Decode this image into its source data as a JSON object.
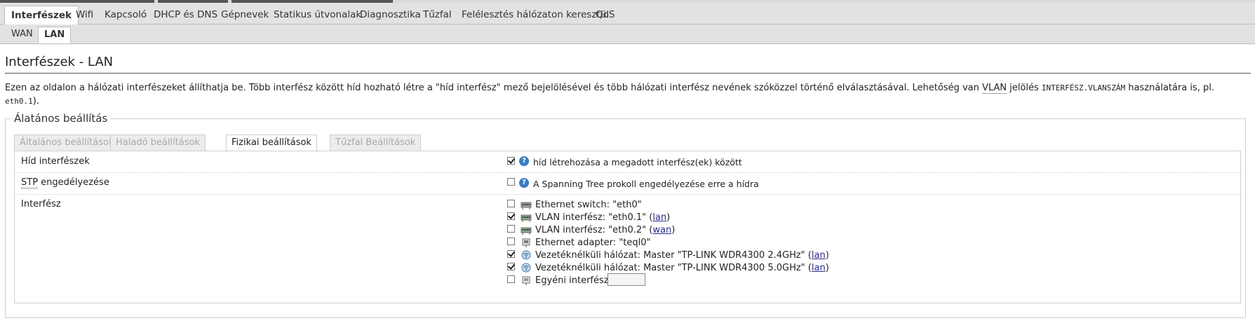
{
  "menu": {
    "tabs": [
      {
        "label": "Interfészek",
        "active": true
      },
      {
        "label": "Wifi"
      },
      {
        "label": "Kapcsoló"
      },
      {
        "label": "DHCP és DNS"
      },
      {
        "label": "Gépnevek"
      },
      {
        "label": "Statikus útvonalak"
      },
      {
        "label": "Diagnosztika"
      },
      {
        "label": "Tűzfal"
      },
      {
        "label": "Felélesztés hálózaton keresztül"
      },
      {
        "label": "QoS"
      }
    ]
  },
  "subtabs": [
    {
      "label": "WAN"
    },
    {
      "label": "LAN",
      "active": true
    }
  ],
  "page": {
    "title": "Interfészek - LAN",
    "desc_part1": "Ezen az oldalon a hálózati interfészeket állíthatja be. Több interfész között híd hozható létre a \"híd interfész\" mező bejelölésével és több hálózati interfész nevének szóközzel történő elválasztásával. Lehetőség van ",
    "desc_vlan": "VLAN",
    "desc_part2": " jelölés ",
    "desc_code1": "INTERFÉSZ.VLANSZÁM",
    "desc_part3": " használatára is, pl. ",
    "desc_code2": "eth0.1",
    "desc_part4": ")."
  },
  "section": {
    "legend": "Álatános beállítás",
    "tabs": [
      {
        "label": "Általános beállítások"
      },
      {
        "label": "Haladó beállítások"
      },
      {
        "label": "Fizikai beállítások",
        "active": true
      },
      {
        "label": "Tűzfal Beállítások"
      }
    ]
  },
  "fields": {
    "bridge": {
      "label": "Híd interfészek",
      "checked": true,
      "help_icon": "help-icon",
      "description": "híd létrehozása a megadott interfész(ek) között"
    },
    "stp": {
      "label_abbr": "STP",
      "label_rest": " engedélyezése",
      "checked": false,
      "help_icon": "help-icon",
      "description": "A Spanning Tree prokoll engedélyezése erre a hídra"
    },
    "ifaces": {
      "label": "Interfész",
      "items": [
        {
          "checked": false,
          "icon": "ethernet-switch-icon",
          "text": "Ethernet switch: \"eth0\"",
          "link": "",
          "suffix": ""
        },
        {
          "checked": true,
          "icon": "vlan-icon",
          "text": "VLAN interfész: \"eth0.1\" (",
          "link": "lan",
          "suffix": ")"
        },
        {
          "checked": false,
          "icon": "vlan-icon",
          "text": "VLAN interfész: \"eth0.2\" (",
          "link": "wan",
          "suffix": ")"
        },
        {
          "checked": false,
          "icon": "ethernet-adapter-icon",
          "text": "Ethernet adapter: \"teql0\"",
          "link": "",
          "suffix": ""
        },
        {
          "checked": true,
          "icon": "wireless-icon",
          "text": "Vezetéknélküli hálózat: Master \"TP-LINK WDR4300 2.4GHz\" (",
          "link": "lan",
          "suffix": ")"
        },
        {
          "checked": true,
          "icon": "wireless-icon",
          "text": "Vezetéknélküli hálózat: Master \"TP-LINK WDR4300 5.0GHz\" (",
          "link": "lan",
          "suffix": ")"
        },
        {
          "checked": false,
          "icon": "custom-interface-icon",
          "text": "Egyéni interfész:",
          "link": "",
          "suffix": "",
          "input": true,
          "value": ""
        }
      ]
    }
  }
}
